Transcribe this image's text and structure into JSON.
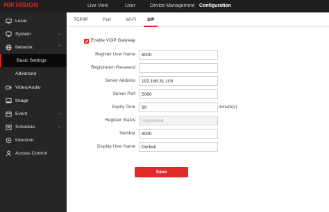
{
  "brand": {
    "logo_text": "HIKVISION",
    "accent": "#d8232a"
  },
  "topnav": [
    {
      "label": "Live View"
    },
    {
      "label": "User"
    },
    {
      "label": "Device Management"
    },
    {
      "label": "Configuration",
      "active": true
    }
  ],
  "sidebar": {
    "items": [
      {
        "label": "Local",
        "icon": "monitor-icon"
      },
      {
        "label": "System",
        "icon": "system-icon",
        "chevron": "⌄"
      },
      {
        "label": "Network",
        "icon": "globe-icon",
        "chevron": "⌃"
      },
      {
        "label": "Basic Settings",
        "sub": true,
        "active": true
      },
      {
        "label": "Advanced",
        "sub": true
      },
      {
        "label": "Video/Audio",
        "icon": "video-icon"
      },
      {
        "label": "Image",
        "icon": "image-icon"
      },
      {
        "label": "Event",
        "icon": "calendar-icon",
        "chevron": "⌄"
      },
      {
        "label": "Schedule",
        "icon": "schedule-icon",
        "chevron": "⌄"
      },
      {
        "label": "Intercom",
        "icon": "intercom-icon"
      },
      {
        "label": "Access Control",
        "icon": "person-icon"
      }
    ]
  },
  "tabs": [
    {
      "label": "TCP/IP"
    },
    {
      "label": "Port"
    },
    {
      "label": "Wi-Fi"
    },
    {
      "label": "SIP",
      "active": true
    }
  ],
  "form": {
    "enable_label": "Enable VOIP Gateway",
    "enable_checked": true,
    "fields": [
      {
        "label": "Register User Name",
        "value": "8000"
      },
      {
        "label": "Registration Password",
        "value": ""
      },
      {
        "label": "Server Address",
        "value": "192.168.31.103"
      },
      {
        "label": "Server Port",
        "value": "5060"
      },
      {
        "label": "Expiry Time",
        "value": "60",
        "unit": "minute(s)"
      },
      {
        "label": "Register Status",
        "value": "Registered",
        "disabled": true
      },
      {
        "label": "Number",
        "value": "8000"
      },
      {
        "label": "Display User Name",
        "value": "Dorbell"
      }
    ],
    "save_label": "Save"
  }
}
